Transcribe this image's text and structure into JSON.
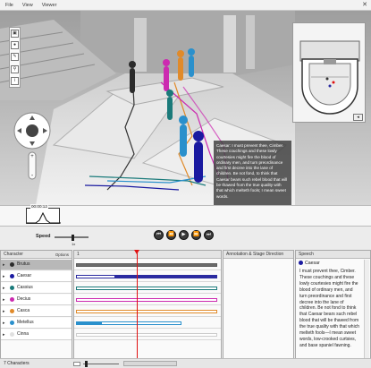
{
  "menu": [
    "File",
    "View",
    "Viewer"
  ],
  "window": {
    "close_glyph": "✕"
  },
  "viewport": {
    "toolbar_icons": [
      "camera-icon",
      "record-icon",
      "edit-icon",
      "figure-icon",
      "info-icon"
    ],
    "toolbar_glyphs": [
      "▣",
      "●",
      "✎",
      "⚲",
      "i"
    ],
    "speech_overlay": "Caesar: I must prevent thee, Cimber. These couchings and these lowly courtesies might fire the blood of ordinary men, and turn preordinance and first decree into the lane of children. Be not fond, to think that Caesar bears such rebel blood that will be thawed from the true quality with that which melteth fools; I mean sweet words.",
    "minimap_button": "◂"
  },
  "timeline": {
    "time": "00:00:12"
  },
  "transport": {
    "speed_label": "Speed",
    "speed_value": "1x",
    "buttons": [
      "⏮",
      "⏪",
      "▶",
      "⏩",
      "⏭"
    ]
  },
  "characters_panel": {
    "header": "Character",
    "options_label": "Options",
    "footer": "7 Characters",
    "items": [
      {
        "name": "Brutus",
        "color": "#2b2b2b",
        "selected": true
      },
      {
        "name": "Caesar",
        "color": "#1a1aa0",
        "selected": false
      },
      {
        "name": "Cassius",
        "color": "#1a7a7a",
        "selected": false
      },
      {
        "name": "Decius",
        "color": "#cc2ab0",
        "selected": false
      },
      {
        "name": "Casca",
        "color": "#e08a2a",
        "selected": false
      },
      {
        "name": "Metellus",
        "color": "#2a90cc",
        "selected": false
      },
      {
        "name": "Cinna",
        "color": "#e0e0e0",
        "selected": false
      }
    ]
  },
  "lanes_panel": {
    "header": "1",
    "lanes": [
      {
        "color": "#5a5a5a"
      },
      {
        "color": "#2a2aa0"
      },
      {
        "color": "#1a7a7a"
      },
      {
        "color": "#cc2ab0"
      },
      {
        "color": "#e08a2a"
      },
      {
        "color": "#2a90cc"
      },
      {
        "color": "#cccccc"
      }
    ]
  },
  "annotation_panel": {
    "header": "Annotation & Stage Direction"
  },
  "speech_panel": {
    "header": "Speech",
    "speaker": "Caesar",
    "speaker_color": "#1a1aa0",
    "text": "I must prevent thee, Cimber. These couchings and these lowly courtesies might fire the blood of ordinary men, and turn preordinance and first decree into the lane of children. Be not fond to think that Caesar bears such rebel blood that will be thawed from the true quality with that which melteth fools—I mean sweet words, low-crooked curtsies, and base spaniel fawning."
  }
}
